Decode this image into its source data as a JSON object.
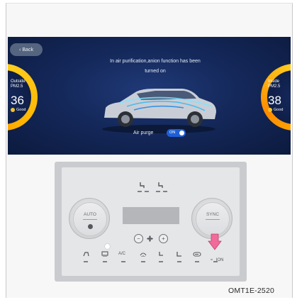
{
  "screen": {
    "back_label": "Back",
    "message_line1": "In air purification,anion function has been",
    "message_line2": "turned on",
    "outside": {
      "label_line1": "Outside",
      "label_line2": "PM2.5",
      "value": "36",
      "status": "Good"
    },
    "inside": {
      "label_line1": "Inside",
      "label_line2": "PM2.5",
      "value": "38",
      "status": "Good"
    },
    "air_purge_label": "Air purge",
    "air_purge_toggle": "ON"
  },
  "panel": {
    "left_knob_label": "AUTO",
    "right_knob_label": "SYNC",
    "ac_label": "A/C",
    "ion_label": "ION"
  },
  "figure_code": "OMT1E-2520",
  "colors": {
    "gauge_ring": "#ffb300",
    "toggle_on": "#1f5fd6",
    "arrow": "#f06a9a",
    "screen_bg": "#14285a"
  }
}
